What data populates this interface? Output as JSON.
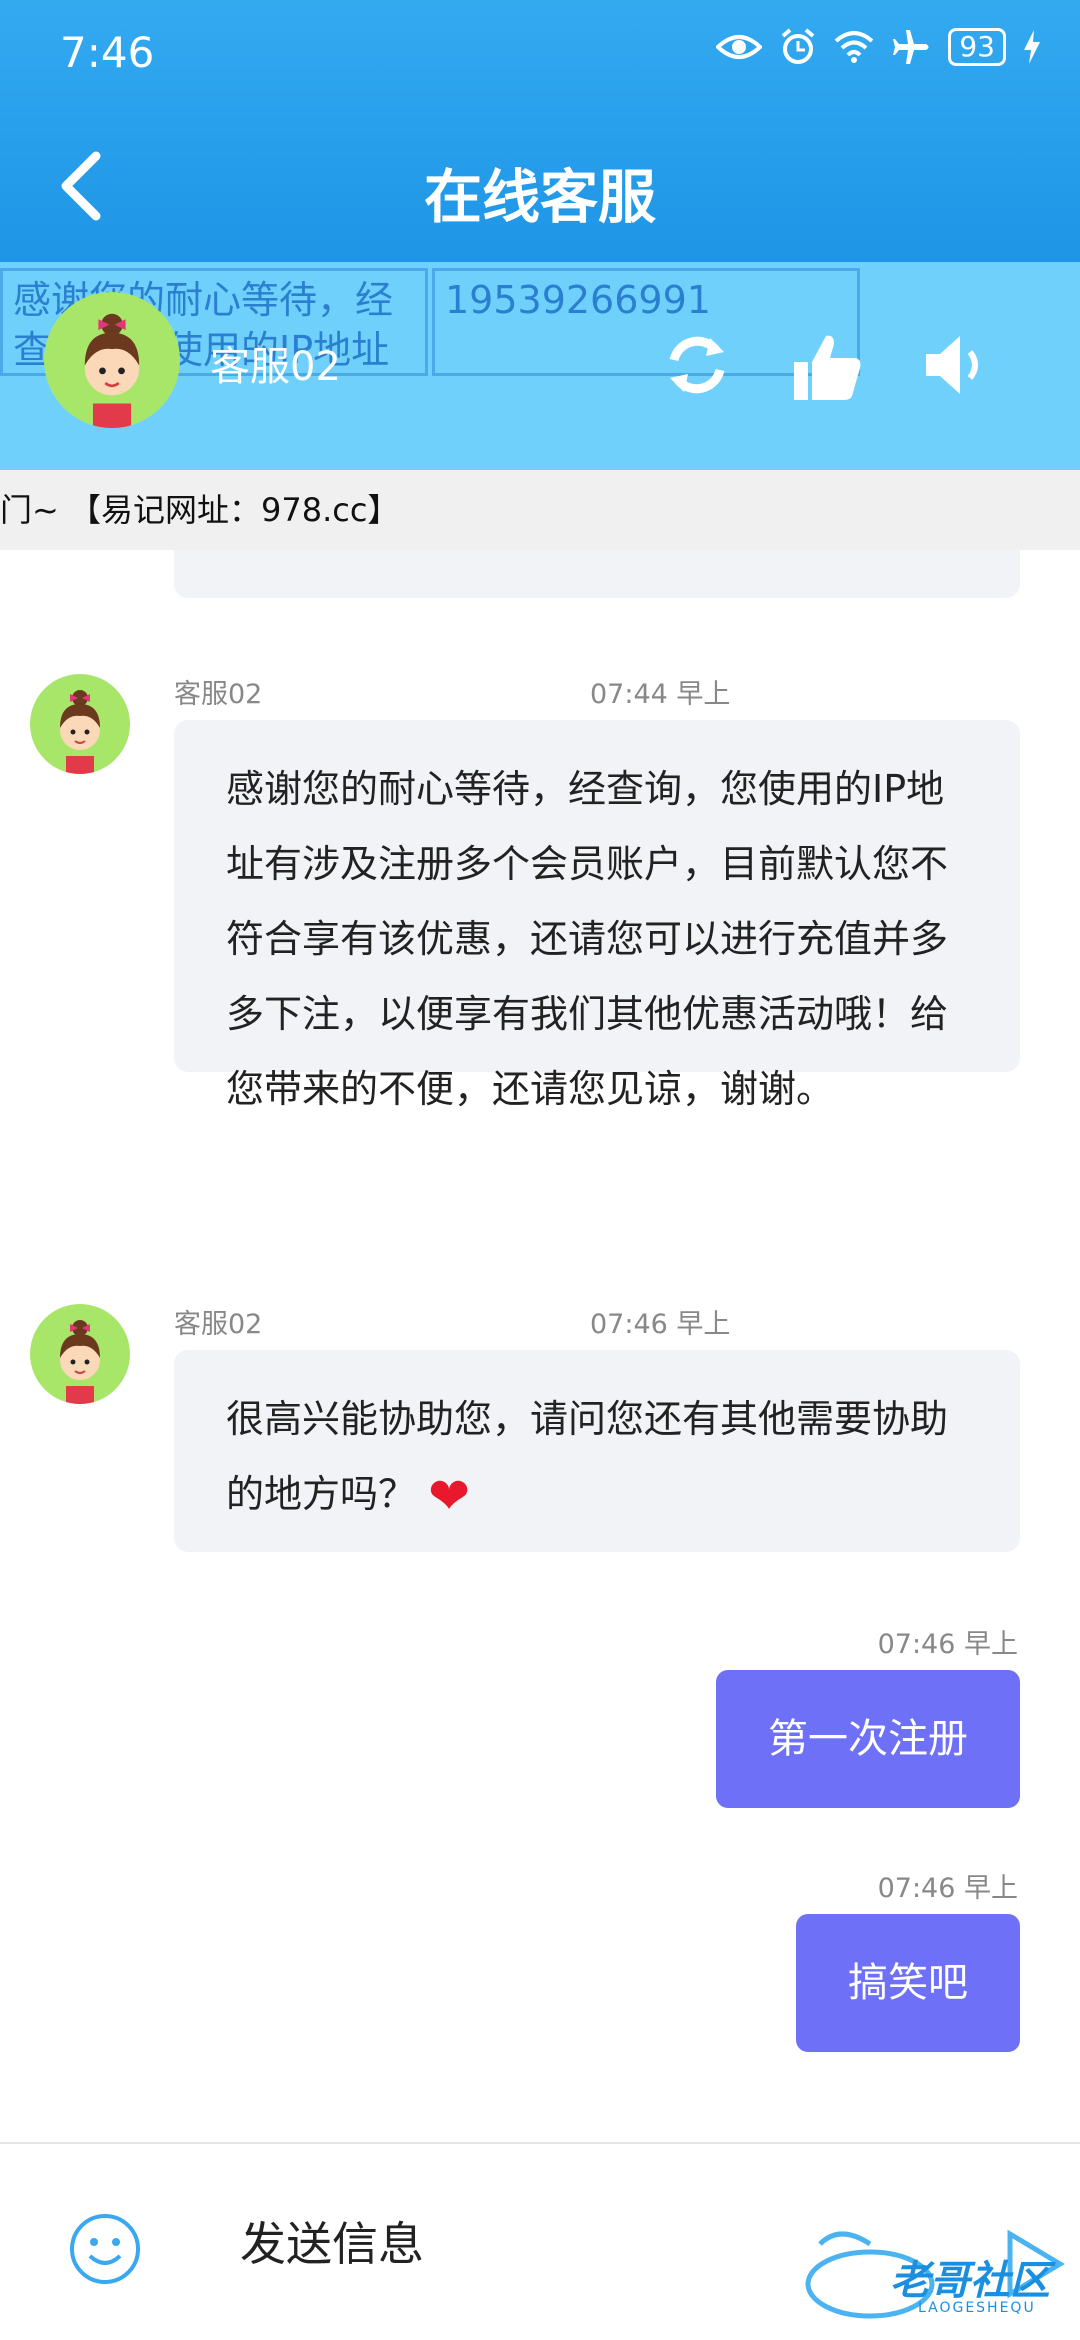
{
  "status": {
    "time": "7:46",
    "battery": "93"
  },
  "header": {
    "title": "在线客服"
  },
  "agent_bar": {
    "agent_name": "客服02",
    "ghost_text_1": "感谢您的耐心等待，经查询，您使用的IP地址",
    "ghost_text_2": "19539266991"
  },
  "marquee": {
    "text": "门~ 【易记网址：978.cc】"
  },
  "messages": [
    {
      "sender": "客服02",
      "time": "07:44 早上",
      "text": "感谢您的耐心等待，经查询，您使用的IP地址有涉及注册多个会员账户，目前默认您不符合享有该优惠，还请您可以进行充值并多多下注，以便享有我们其他优惠活动哦！给您带来的不便，还请您见谅，谢谢。"
    },
    {
      "sender": "客服02",
      "time": "07:46 早上",
      "text": "很高兴能协助您，请问您还有其他需要协助的地方吗？",
      "emoji": "❤"
    },
    {
      "time": "07:46 早上",
      "text": "第一次注册"
    },
    {
      "time": "07:46 早上",
      "text": "搞笑吧"
    }
  ],
  "input": {
    "placeholder": "发送信息"
  },
  "watermark": {
    "text": "老哥社区",
    "sub": "LAOGESHEQU"
  },
  "colors": {
    "header": "#1e95e6",
    "agent_bar": "#6fd1fb",
    "outgoing_bubble": "#6e71f7",
    "incoming_bubble": "#f1f3f6"
  }
}
